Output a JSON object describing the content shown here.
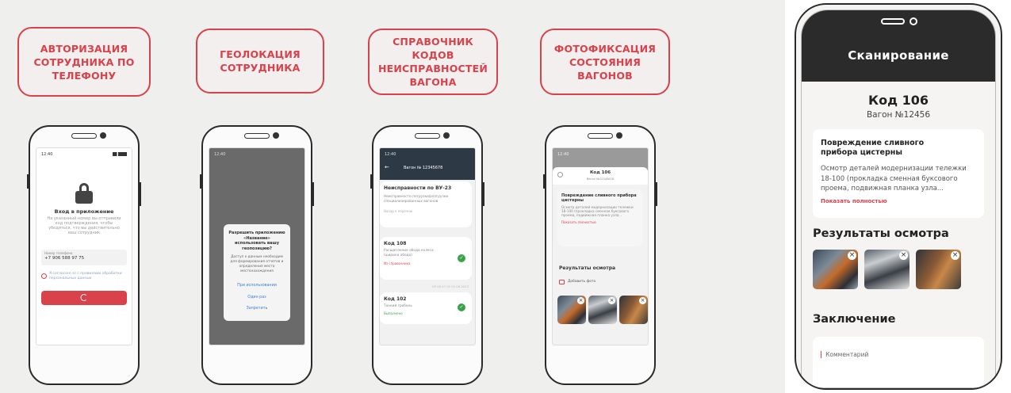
{
  "features": [
    {
      "label": "АВТОРИЗАЦИЯ СОТРУДНИКА ПО ТЕЛЕФОНУ"
    },
    {
      "label": "ГЕОЛОКАЦИЯ СОТРУДНИКА"
    },
    {
      "label": "СПРАВОЧНИК КОДОВ НЕИСПРАВНОСТЕЙ ВАГОНА"
    },
    {
      "label": "ФОТОФИКСАЦИЯ СОСТОЯНИЯ ВАГОНОВ"
    }
  ],
  "phone1": {
    "time": "12:40",
    "login_title": "Вход в приложение",
    "login_text": "На указанный номер вы отправили код подтверждения, чтобы убедиться, что вы действительно ваш сотрудник",
    "phone_label": "Номер телефона",
    "phone_value": "+7 906 588 97 75",
    "consent_text": "Я согласен(-а) с правилами обработки персональных данных"
  },
  "phone2": {
    "time": "12:40",
    "dialog_title": "Разрешить приложению «Название» использовать вашу геопозицию?",
    "dialog_text": "Доступ к данным необходим для формирования отчетов и определения места местонахождения",
    "option1": "При использовании",
    "option2": "Один раз",
    "option3": "Запретить"
  },
  "phone3": {
    "time": "12:40",
    "header": "Вагон № 12345678",
    "section": "Неисправности по ВУ-23",
    "item0_text": "Неисправности погрузки/разгрузки специализированных вагонов",
    "item0_sub": "Назад к перечню",
    "item1_code": "Код 108",
    "item1_text": "Расщепление обода колеса (ширина обода)",
    "item1_sub": "Из справочника",
    "date": "НР 08.07.05 02.06.2023",
    "item2_code": "Код 102",
    "item2_text": "Тонкий гребень",
    "item2_sub": "Выполнено"
  },
  "phone4": {
    "time": "12:40",
    "code": "Код 106",
    "sub": "Вагон №12345678",
    "card_title": "Повреждение сливного прибора цистерны",
    "card_text": "Осмотр деталей модернизации тележки 18-100 (прокладка сменная буксового проема, подвижная планка узла...",
    "card_link": "Показать полностью",
    "results": "Результаты осмотра",
    "add_photo": "Добавить фото"
  },
  "big": {
    "title": "Сканирование",
    "code": "Код 106",
    "wagon": "Вагон №12456",
    "card_title": "Повреждение сливного прибора цистерны",
    "card_text": "Осмотр деталей модернизации тележки 18-100 (прокладка сменная буксового проема, подвижная планка узла...",
    "card_link": "Показать полностью",
    "results": "Результаты осмотра",
    "conclusion": "Заключение",
    "comment_placeholder": "Комментарий"
  },
  "colors": {
    "accent": "#d9414b",
    "dark": "#2b2b2b",
    "green": "#3aa34a"
  }
}
